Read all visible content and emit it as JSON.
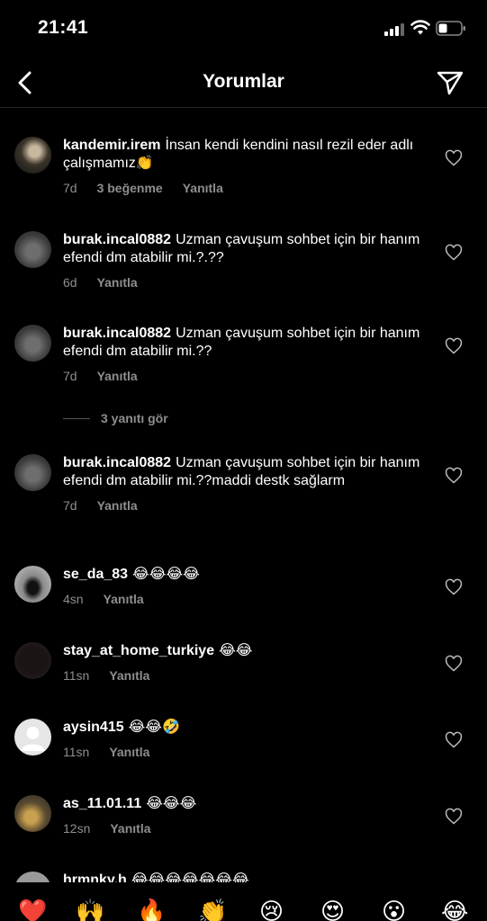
{
  "status": {
    "time": "21:41"
  },
  "header": {
    "title": "Yorumlar"
  },
  "comments": [
    {
      "username": "kandemir.irem",
      "text": "İnsan kendi kendini nasıl rezil eder adlı çalışmamız👏",
      "time": "7d",
      "likes": "3 beğenme",
      "reply": "Yanıtla"
    },
    {
      "username": "burak.incal0882",
      "text": "Uzman çavuşum sohbet için bir hanım efendi dm atabilir mi.?.??",
      "time": "6d",
      "reply": "Yanıtla"
    },
    {
      "username": "burak.incal0882",
      "text": "Uzman çavuşum sohbet için bir hanım efendi dm atabilir mi.??",
      "time": "7d",
      "reply": "Yanıtla"
    },
    {
      "username": "burak.incal0882",
      "text": "Uzman çavuşum sohbet için bir hanım efendi dm atabilir mi.??maddi destk sağlarm",
      "time": "7d",
      "reply": "Yanıtla"
    },
    {
      "username": "se_da_83",
      "text": "😂😂😂😂",
      "time": "4sn",
      "reply": "Yanıtla"
    },
    {
      "username": "stay_at_home_turkiye",
      "text": "😂😂",
      "time": "11sn",
      "reply": "Yanıtla"
    },
    {
      "username": "aysin415",
      "text": "😂😂🤣",
      "time": "11sn",
      "reply": "Yanıtla"
    },
    {
      "username": "as_11.01.11",
      "text": "😂😂😂",
      "time": "12sn",
      "reply": "Yanıtla"
    },
    {
      "username": "hrmnky.h",
      "text": "😂😂😂😂😂😂😂"
    }
  ],
  "view_replies": "3 yanıtı gör",
  "emoji_bar": [
    "❤️",
    "🙌",
    "🔥",
    "👏",
    "😢",
    "😍",
    "😮",
    "😂"
  ],
  "colors": {
    "background": "#000000",
    "secondary_text": "#8e8e8e",
    "divider": "#262626"
  }
}
